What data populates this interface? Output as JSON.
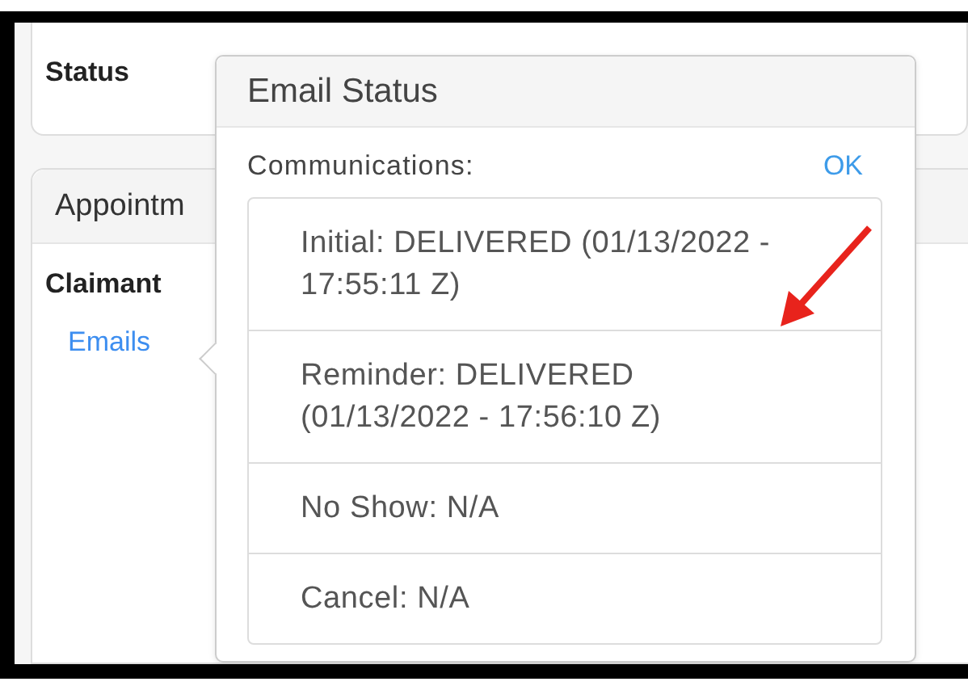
{
  "status_card": {
    "label": "Status"
  },
  "appointment_card": {
    "header": "Appointm",
    "claimant_label": "Claimant",
    "emails_link": "Emails"
  },
  "popover": {
    "title": "Email Status",
    "section_label": "Communications:",
    "ok_button": "OK",
    "communications": [
      {
        "text": "Initial: DELIVERED (01/13/2022 - 17:55:11 Z)"
      },
      {
        "text": "Reminder: DELIVERED (01/13/2022 - 17:56:10 Z)"
      },
      {
        "text": "No Show: N/A"
      },
      {
        "text": "Cancel: N/A"
      }
    ]
  }
}
